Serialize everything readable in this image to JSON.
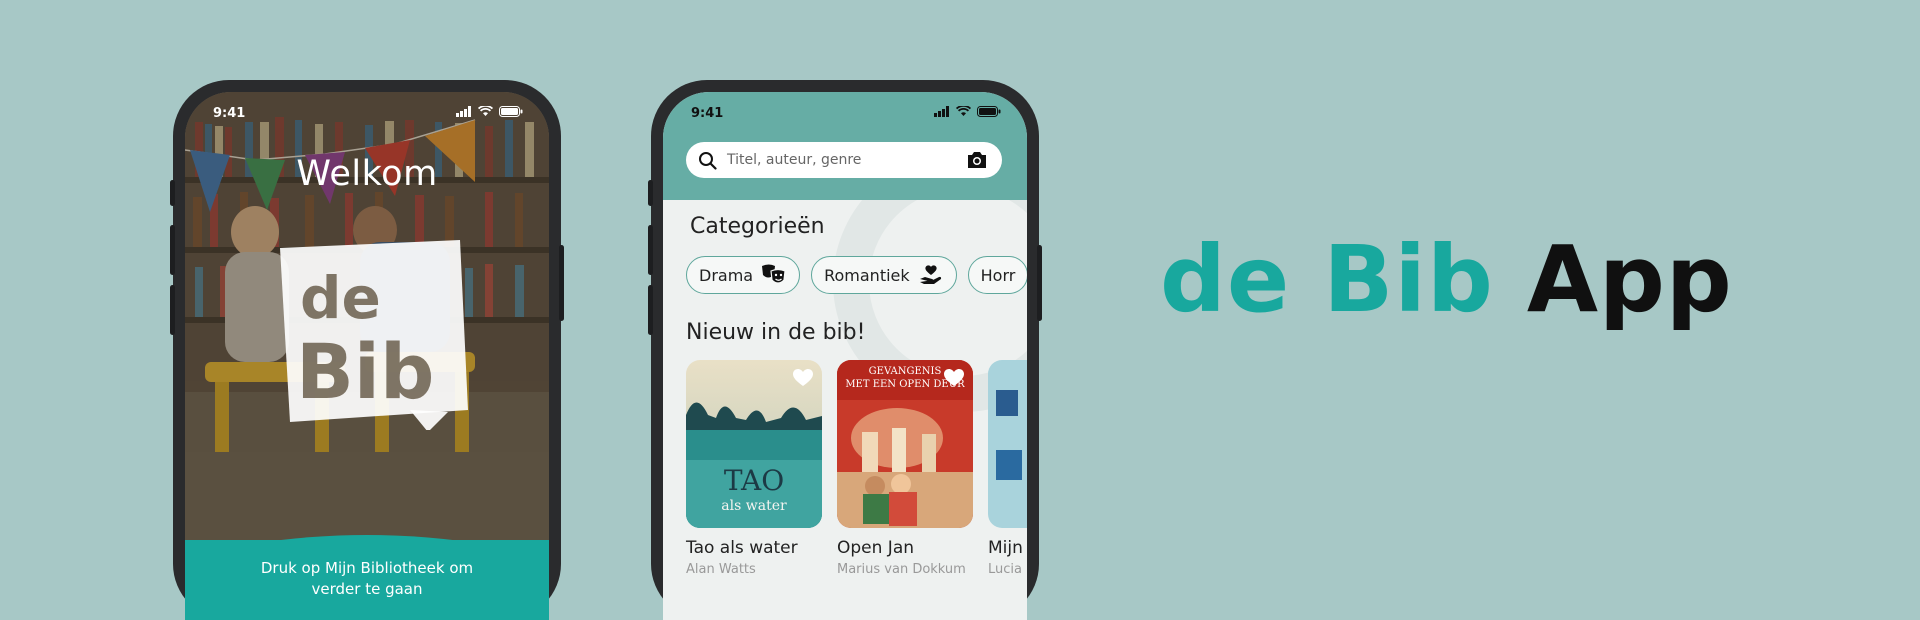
{
  "colors": {
    "background": "#a7c8c6",
    "accent": "#18a89e",
    "header": "#66ada5",
    "text_dark": "#101010"
  },
  "phone1": {
    "status_time": "9:41",
    "title": "Welkom",
    "logo": "de Bib",
    "footer_text": "Druk op Mijn Bibliotheek om verder te gaan"
  },
  "phone2": {
    "status_time": "9:41",
    "search": {
      "placeholder": "Titel, auteur, genre"
    },
    "categories_title": "Categorieën",
    "categories": [
      {
        "label": "Drama",
        "icon": "theater-masks-icon"
      },
      {
        "label": "Romantiek",
        "icon": "heart-hand-icon"
      },
      {
        "label": "Horr",
        "icon": ""
      }
    ],
    "new_title": "Nieuw in de bib!",
    "books": [
      {
        "title": "Tao als water",
        "author": "Alan Watts",
        "cover_title": "TAO",
        "cover_subtitle": "als water"
      },
      {
        "title": "Open Jan",
        "author": "Marius van Dokkum",
        "cover_title": "GEVANGENIS MET EEN OPEN DEUR"
      },
      {
        "title": "Mijn",
        "author": "Lucia"
      }
    ]
  },
  "brand": {
    "part1": "de Bib",
    "part2": "App"
  }
}
